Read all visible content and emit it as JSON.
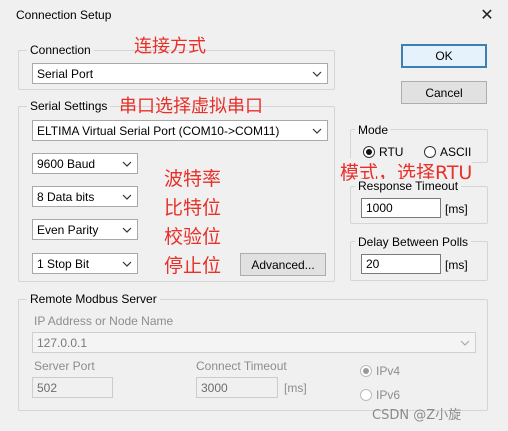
{
  "window": {
    "title": "Connection Setup",
    "close_glyph": "✕"
  },
  "buttons": {
    "ok": "OK",
    "cancel": "Cancel",
    "advanced": "Advanced..."
  },
  "connection": {
    "label": "Connection",
    "value": "Serial Port"
  },
  "serial_settings": {
    "label": "Serial Settings",
    "port": "ELTIMA Virtual Serial Port (COM10->COM11)",
    "baud": "9600 Baud",
    "data_bits": "8 Data bits",
    "parity": "Even Parity",
    "stop_bits": "1 Stop Bit"
  },
  "mode": {
    "label": "Mode",
    "rtu": "RTU",
    "ascii": "ASCII",
    "selected": "RTU"
  },
  "response_timeout": {
    "label": "Response Timeout",
    "value": "1000",
    "unit": "[ms]"
  },
  "delay_between_polls": {
    "label": "Delay Between Polls",
    "value": "20",
    "unit": "[ms]"
  },
  "remote_server": {
    "label": "Remote Modbus Server",
    "ip_label": "IP Address or Node Name",
    "ip_value": "127.0.0.1",
    "server_port_label": "Server Port",
    "server_port_value": "502",
    "connect_timeout_label": "Connect Timeout",
    "connect_timeout_value": "3000",
    "connect_timeout_unit": "[ms]",
    "ipv4": "IPv4",
    "ipv6": "IPv6"
  },
  "annotations": {
    "connection_mode": "连接方式",
    "serial_virtual": "串口选择虚拟串口",
    "baud_rate": "波特率",
    "data_bit": "比特位",
    "parity_bit": "校验位",
    "stop_bit": "停止位",
    "mode_rtu": "模式，选择RTU"
  },
  "watermark": "CSDN @Z小旋",
  "colors": {
    "annotation": "#e8302a",
    "default_button_border": "#3c7fb1"
  }
}
